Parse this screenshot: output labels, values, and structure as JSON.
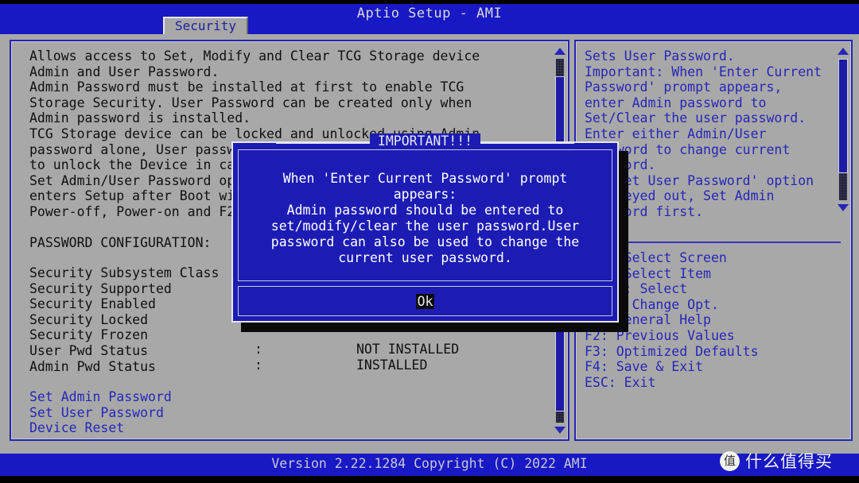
{
  "header": {
    "title": "Aptio Setup - AMI",
    "tab": "Security"
  },
  "left_panel": {
    "help_text": "Allows access to Set, Modify and Clear TCG Storage device\nAdmin and User Password.\nAdmin Password must be installed at first to enable TCG\nStorage Security. User Password can be created only when\nAdmin password is installed.\nTCG Storage device can be locked and unlocked using Admin\npassword alone, User password can also be used\nto unlock the Device in case Admin password is lost.\nSet Admin/User Password option is available only when User\nenters Setup after Boot with HDD Security Freeze Lock\nPower-off, Power-on and F2 to Setup.",
    "section_title": "PASSWORD CONFIGURATION:",
    "config_labels": "Security Subsystem Class\nSecurity Supported\nSecurity Enabled\nSecurity Locked\nSecurity Frozen\nUser Pwd Status\nAdmin Pwd Status",
    "user_pwd_status_label": "User Pwd Status",
    "user_pwd_status_value": "NOT INSTALLED",
    "admin_pwd_status_label": "Admin Pwd Status",
    "admin_pwd_status_value": "INSTALLED",
    "menu_items": "Set Admin Password\nSet User Password\nDevice Reset"
  },
  "right_panel": {
    "help_text": "Sets User Password.\nImportant: When 'Enter Current\nPassword' prompt appears,\nenter Admin password to\nSet/Clear the user password.\nEnter either Admin/User\npassword to change current\npassword.\nIf 'Set User Password' option\nis greyed out, Set Admin\npassword first.",
    "keys": ">< : Select Screen\n^v : Select Item\nEnter: Select\n+/- : Change Opt.\nF1: General Help\nF2: Previous Values\nF3: Optimized Defaults\nF4: Save & Exit\nESC: Exit"
  },
  "dialog": {
    "title": "IMPORTANT!!!",
    "message": "When 'Enter Current Password' prompt\nappears:\nAdmin password should be entered to\nset/modify/clear the user password.User\npassword can also be used to change the\ncurrent user password.",
    "ok_label": "Ok"
  },
  "footer": {
    "version_text": "Version 2.22.1284 Copyright (C) 2022 AMI"
  },
  "watermark": {
    "logo_char": "值",
    "text": "什么值得买"
  },
  "colors": {
    "bios_blue": "#1818c4",
    "panel_grey": "#a8a8a8",
    "text_blue": "#2626b8",
    "text_dark": "#101010",
    "dialog_blue": "#1c1cb4"
  }
}
